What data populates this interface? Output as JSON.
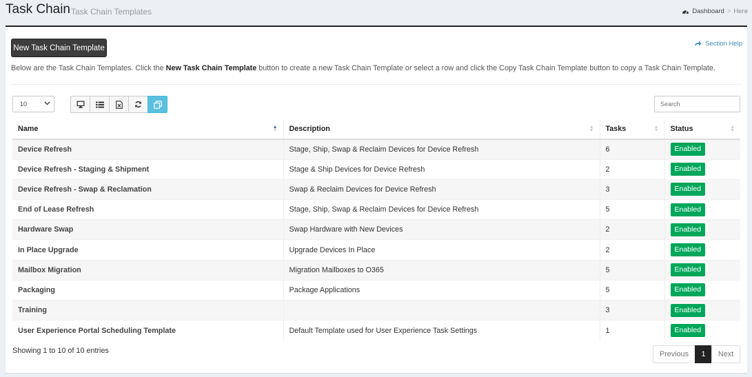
{
  "header": {
    "title": "Task Chain",
    "subtitle": "Task Chain Templates",
    "breadcrumb": {
      "dashboard": "Dashboard",
      "separator": ">",
      "current": "Here"
    }
  },
  "toolbar": {
    "new_button": "New Task Chain Template",
    "section_help": "Section Help",
    "intro_before": "Below are the Task Chain Templates. Click the ",
    "intro_bold": "New Task Chain Template",
    "intro_after": " button to create a new Task Chain Template or select a row and click the Copy Task Chain Template button to copy a Task Chain Template."
  },
  "table_controls": {
    "page_length": "10",
    "search_placeholder": "Search",
    "tools": [
      "desktop-icon",
      "list-icon",
      "excel-icon",
      "refresh-icon",
      "copy-icon"
    ]
  },
  "table": {
    "columns": [
      "Name",
      "Description",
      "Tasks",
      "Status"
    ],
    "rows": [
      {
        "name": "Device Refresh",
        "description": "Stage, Ship, Swap & Reclaim Devices for Device Refresh",
        "tasks": "6",
        "status": "Enabled"
      },
      {
        "name": "Device Refresh - Staging & Shipment",
        "description": "Stage & Ship Devices for Device Refresh",
        "tasks": "2",
        "status": "Enabled"
      },
      {
        "name": "Device Refresh - Swap & Reclamation",
        "description": "Swap & Reclaim Devices for Device Refresh",
        "tasks": "3",
        "status": "Enabled"
      },
      {
        "name": "End of Lease Refresh",
        "description": "Stage, Ship, Swap & Reclaim Devices for Device Refresh",
        "tasks": "5",
        "status": "Enabled"
      },
      {
        "name": "Hardware Swap",
        "description": "Swap Hardware with New Devices",
        "tasks": "2",
        "status": "Enabled"
      },
      {
        "name": "In Place Upgrade",
        "description": "Upgrade Devices In Place",
        "tasks": "2",
        "status": "Enabled"
      },
      {
        "name": "Mailbox Migration",
        "description": "Migration Mailboxes to O365",
        "tasks": "5",
        "status": "Enabled"
      },
      {
        "name": "Packaging",
        "description": "Package Applications",
        "tasks": "5",
        "status": "Enabled"
      },
      {
        "name": "Training",
        "description": "",
        "tasks": "3",
        "status": "Enabled"
      },
      {
        "name": "User Experience Portal Scheduling Template",
        "description": "Default Template used for User Experience Task Settings",
        "tasks": "1",
        "status": "Enabled"
      }
    ]
  },
  "footer": {
    "info": "Showing 1 to 10 of 10 entries",
    "previous": "Previous",
    "current_page": "1",
    "next": "Next"
  },
  "colors": {
    "accent": "#3c8dbc",
    "enabled": "#00a65a",
    "primary_button": "#3d3d3d",
    "active_tool": "#5bc0de"
  }
}
